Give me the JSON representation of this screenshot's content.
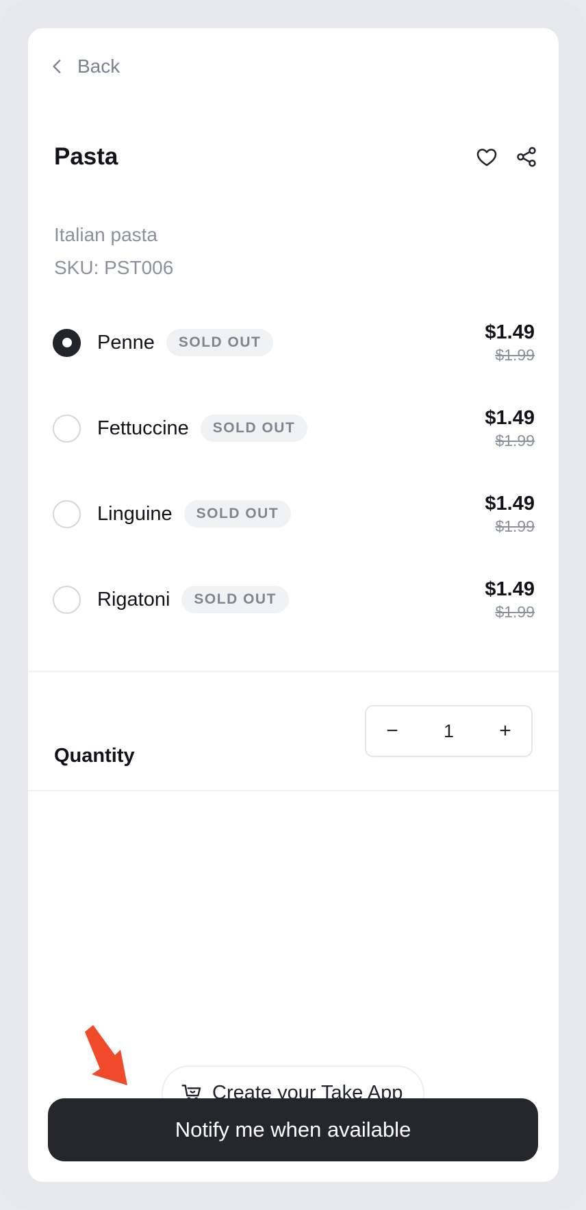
{
  "nav": {
    "back_label": "Back"
  },
  "product": {
    "title": "Pasta",
    "description": "Italian pasta",
    "sku": "SKU: PST006"
  },
  "variants": [
    {
      "name": "Penne",
      "badge": "SOLD OUT",
      "price": "$1.49",
      "old_price": "$1.99",
      "selected": true
    },
    {
      "name": "Fettuccine",
      "badge": "SOLD OUT",
      "price": "$1.49",
      "old_price": "$1.99",
      "selected": false
    },
    {
      "name": "Linguine",
      "badge": "SOLD OUT",
      "price": "$1.49",
      "old_price": "$1.99",
      "selected": false
    },
    {
      "name": "Rigatoni",
      "badge": "SOLD OUT",
      "price": "$1.49",
      "old_price": "$1.99",
      "selected": false
    }
  ],
  "quantity": {
    "label": "Quantity",
    "value": "1",
    "minus": "−",
    "plus": "+"
  },
  "promo": {
    "label": "Create your Take App",
    "icon": "cart-smile-icon"
  },
  "cta": {
    "label": "Notify me when available"
  },
  "icons": {
    "favorite": "heart-icon",
    "share": "share-icon",
    "back": "chevron-left-icon",
    "annotation": "arrow-icon"
  },
  "colors": {
    "primary": "#24262c",
    "annotation": "#f04a2a",
    "muted": "#8b909c",
    "badge_bg": "#f1f2f4"
  }
}
